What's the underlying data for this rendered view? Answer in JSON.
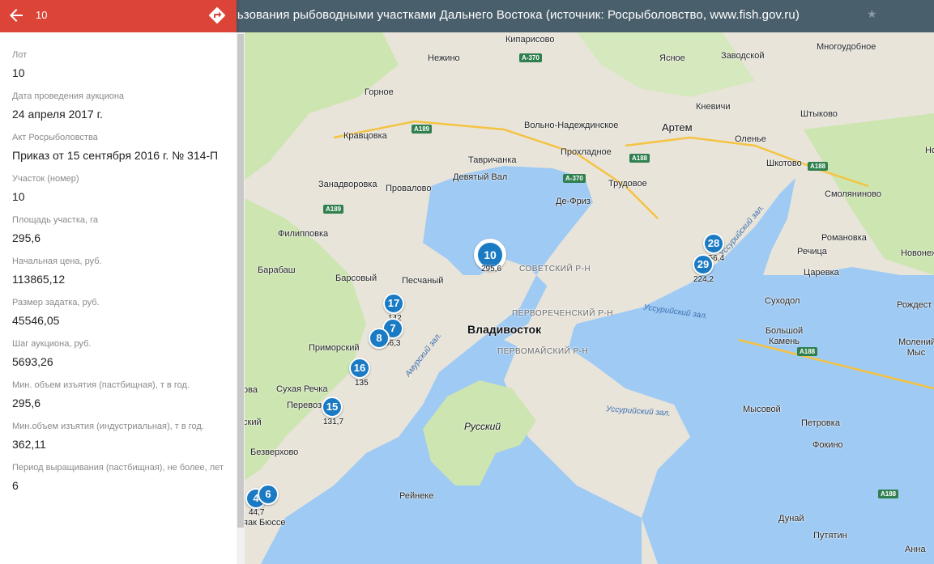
{
  "header": {
    "title": "льзования рыбоводными участками Дальнего Востока (источник: Росрыболовство, www.fish.gov.ru)",
    "star_icon": "star-icon"
  },
  "panel": {
    "title": "10",
    "back_icon": "arrow-back-icon",
    "directions_icon": "directions-icon",
    "accent": "#db4437",
    "fields": [
      {
        "label": "Лот",
        "value": "10"
      },
      {
        "label": "Дата проведения аукциона",
        "value": "24 апреля 2017 г."
      },
      {
        "label": "Акт Росрыболовства",
        "value": "Приказ от 15 сентября 2016 г. № 314-П"
      },
      {
        "label": "Участок (номер)",
        "value": "10"
      },
      {
        "label": "Площадь участка, га",
        "value": "295,6"
      },
      {
        "label": "Начальная цена, руб.",
        "value": "113865,12"
      },
      {
        "label": "Размер задатка, руб.",
        "value": "45546,05"
      },
      {
        "label": "Шаг аукциона, руб.",
        "value": "5693,26"
      },
      {
        "label": "Мин. объем изъятия (пастбищная), т в год.",
        "value": "295,6"
      },
      {
        "label": "Мин.объем изъятия (индустриальная), т в год.",
        "value": "362,11"
      },
      {
        "label": "Период выращивания (пастбищная), не более, лет",
        "value": "6"
      }
    ]
  },
  "map": {
    "places": [
      {
        "name": "Кипарисово"
      },
      {
        "name": "Нежино"
      },
      {
        "name": "Ясное"
      },
      {
        "name": "Заводской"
      },
      {
        "name": "Многоудобное"
      },
      {
        "name": "Горное"
      },
      {
        "name": "Кневичи"
      },
      {
        "name": "Штыково"
      },
      {
        "name": "Вольно-Надеждинское"
      },
      {
        "name": "Артем"
      },
      {
        "name": "Кравцовка"
      },
      {
        "name": "Оленье"
      },
      {
        "name": "Прохладное"
      },
      {
        "name": "Тавричанка"
      },
      {
        "name": "Шкотово"
      },
      {
        "name": "Девятый Вал"
      },
      {
        "name": "Трудовое"
      },
      {
        "name": "Занадворовка"
      },
      {
        "name": "Провалово"
      },
      {
        "name": "Смоляниново"
      },
      {
        "name": "Де-Фриз"
      },
      {
        "name": "Филипповка"
      },
      {
        "name": "Романовка"
      },
      {
        "name": "Речица"
      },
      {
        "name": "Барабаш"
      },
      {
        "name": "Барсовый"
      },
      {
        "name": "Песчаный"
      },
      {
        "name": "Царевка"
      },
      {
        "name": "Суходол"
      },
      {
        "name": "Приморский"
      },
      {
        "name": "Большой Камень"
      },
      {
        "name": "Сухая Речка"
      },
      {
        "name": "Перевоз"
      },
      {
        "name": "Мысовой"
      },
      {
        "name": "Петровка"
      },
      {
        "name": "Безверхово"
      },
      {
        "name": "Фокино"
      },
      {
        "name": "Рейнеке"
      },
      {
        "name": "Дунай"
      },
      {
        "name": "Путятин"
      },
      {
        "name": "Анна"
      },
      {
        "name": "Новонеж"
      },
      {
        "name": "Рождест"
      },
      {
        "name": "Молений Мыс"
      },
      {
        "name": "Но"
      },
      {
        "name": "яак Бюссе"
      },
      {
        "name": "ова"
      },
      {
        "name": "ский"
      }
    ],
    "city": "Владивосток",
    "districts": [
      "СОВЕТСКИЙ Р-Н",
      "ПЕРВОРЕЧЕНСКИЙ Р-Н",
      "ПЕРВОМАЙСКИЙ Р-Н"
    ],
    "bays": [
      "Амурский зал.",
      "Уссурийский зал.",
      "Уссурийский зал.",
      "Уссурийский зал."
    ],
    "island": "Русский",
    "roads": [
      "А-370",
      "А189",
      "А188",
      "А-370",
      "А189",
      "А188",
      "А188",
      "А188"
    ],
    "markers": [
      {
        "id": "10",
        "area": "295,6",
        "selected": true
      },
      {
        "id": "17",
        "area": "142"
      },
      {
        "id": "7",
        "area": "96,3"
      },
      {
        "id": "8",
        "area": ""
      },
      {
        "id": "16",
        "area": "135"
      },
      {
        "id": "15",
        "area": "131,7"
      },
      {
        "id": "28",
        "area": "256,4"
      },
      {
        "id": "29",
        "area": "224,2"
      },
      {
        "id": "6",
        "area": "44,7"
      },
      {
        "id": "4",
        "area": ""
      }
    ],
    "colors": {
      "water": "#9fcaf3",
      "land": "#e8e4da",
      "forest": "#cde5b0",
      "marker": "#1a7ac4"
    }
  }
}
